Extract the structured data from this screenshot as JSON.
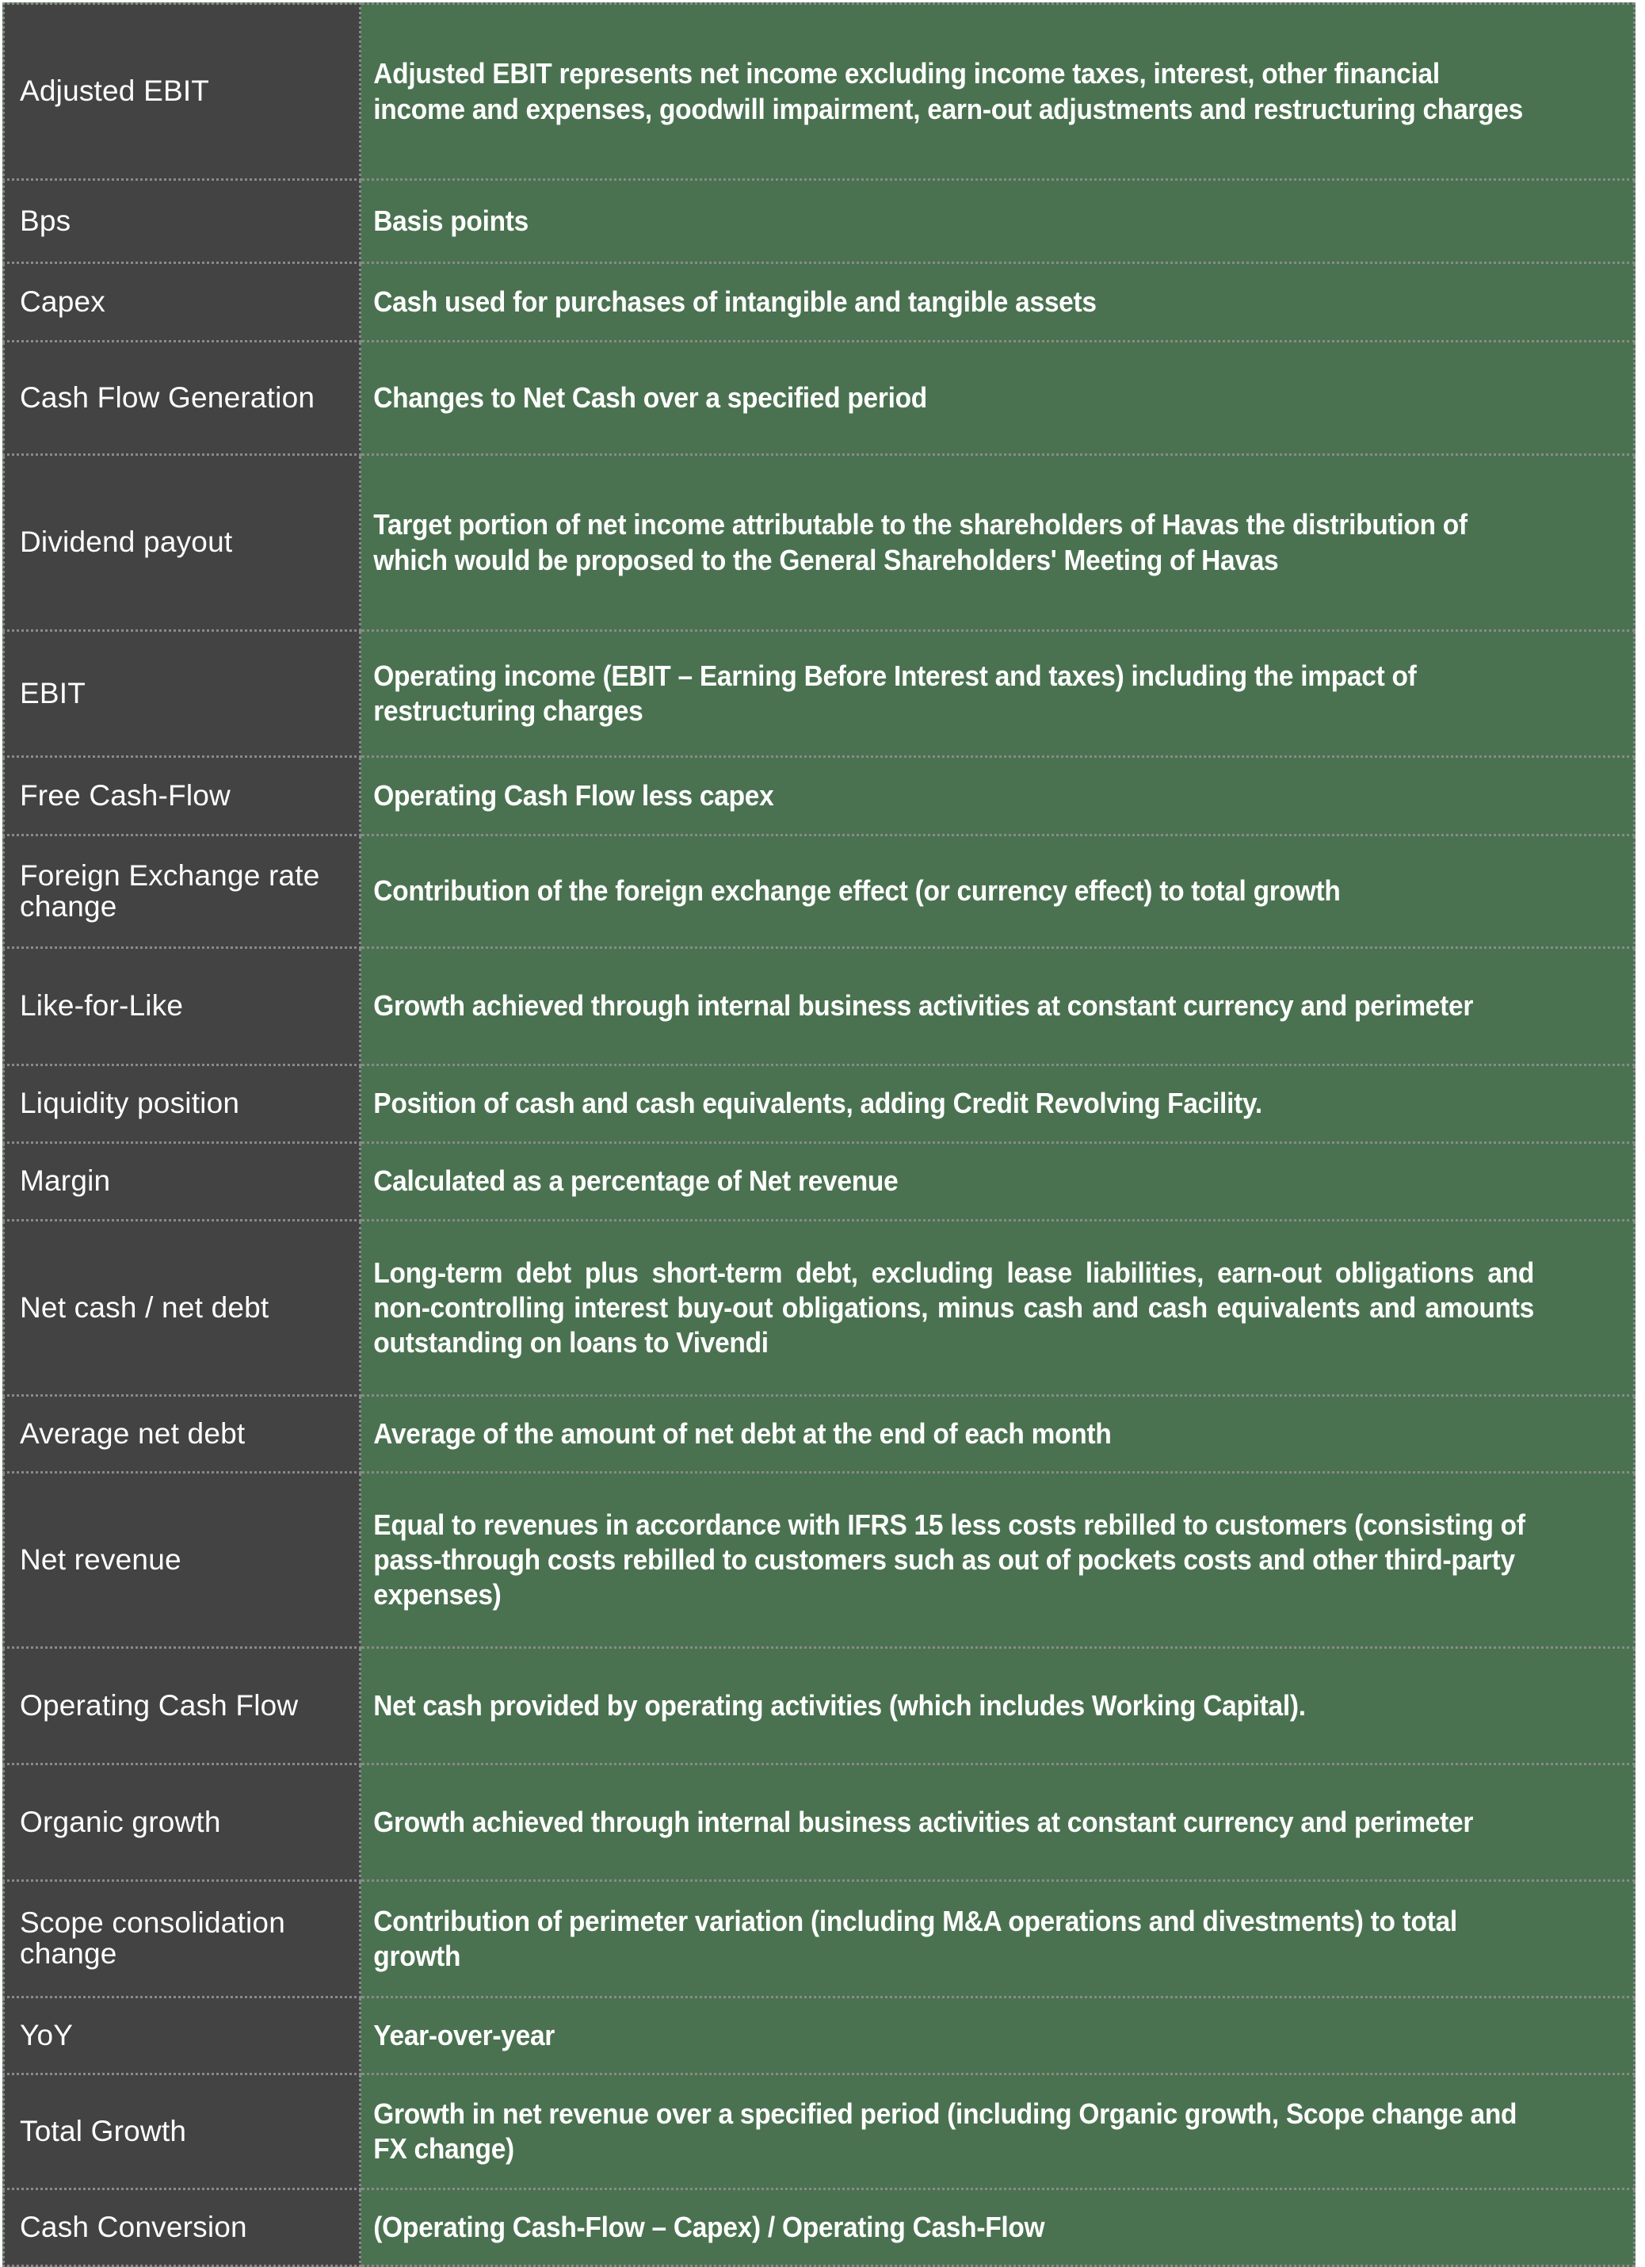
{
  "glossary": {
    "colors": {
      "term_background": "#434343",
      "definition_background": "#4a7250",
      "text": "#ffffff",
      "border": "#8a8a8a"
    },
    "rows": [
      {
        "term": "Adjusted EBIT",
        "definition": "Adjusted EBIT represents net income excluding income taxes, interest, other financial income and expenses, goodwill impairment, earn-out adjustments and restructuring charges"
      },
      {
        "term": "Bps",
        "definition": "Basis points"
      },
      {
        "term": "Capex",
        "definition": "Cash used for purchases of intangible and tangible assets"
      },
      {
        "term": "Cash Flow Generation",
        "definition": "Changes to Net Cash over a specified period"
      },
      {
        "term": "Dividend payout",
        "definition": "Target portion of net income attributable to the shareholders of Havas the distribution of which would be proposed to the General Shareholders' Meeting of Havas"
      },
      {
        "term": "EBIT",
        "definition": "Operating income (EBIT – Earning Before Interest and taxes) including the impact of restructuring charges"
      },
      {
        "term": "Free Cash-Flow",
        "definition": "Operating Cash Flow less capex"
      },
      {
        "term": "Foreign Exchange rate change",
        "definition": "Contribution of the foreign exchange effect (or currency effect) to total growth"
      },
      {
        "term": "Like-for-Like",
        "definition": "Growth achieved through internal business activities at constant currency and perimeter"
      },
      {
        "term": "Liquidity position",
        "definition": "Position of cash and cash equivalents, adding Credit Revolving Facility."
      },
      {
        "term": "Margin",
        "definition": "Calculated as a percentage of Net revenue"
      },
      {
        "term": "Net cash / net debt",
        "definition": "Long-term debt plus short-term debt, excluding lease liabilities, earn-out obligations and non-controlling interest buy-out obligations, minus cash and cash equivalents and amounts outstanding on loans to Vivendi"
      },
      {
        "term": "Average net debt",
        "definition": "Average of the amount of net debt at the end of each month"
      },
      {
        "term": "Net revenue",
        "definition": "Equal to revenues in accordance with IFRS 15 less costs rebilled to customers (consisting of pass-through costs rebilled to customers such as out of pockets costs and other third-party expenses)"
      },
      {
        "term": "Operating Cash Flow",
        "definition": "Net cash provided by operating activities (which includes Working Capital)."
      },
      {
        "term": "Organic growth",
        "definition": "Growth achieved through internal business activities at constant currency and perimeter"
      },
      {
        "term": "Scope consolidation change",
        "definition": "Contribution of perimeter variation (including M&A operations and divestments) to total growth"
      },
      {
        "term": "YoY",
        "definition": "Year-over-year"
      },
      {
        "term": "Total Growth",
        "definition": "Growth in net revenue over a specified period (including Organic growth, Scope change and FX change)"
      },
      {
        "term": "Cash Conversion",
        "definition": "(Operating Cash-Flow – Capex) / Operating Cash-Flow"
      }
    ]
  }
}
